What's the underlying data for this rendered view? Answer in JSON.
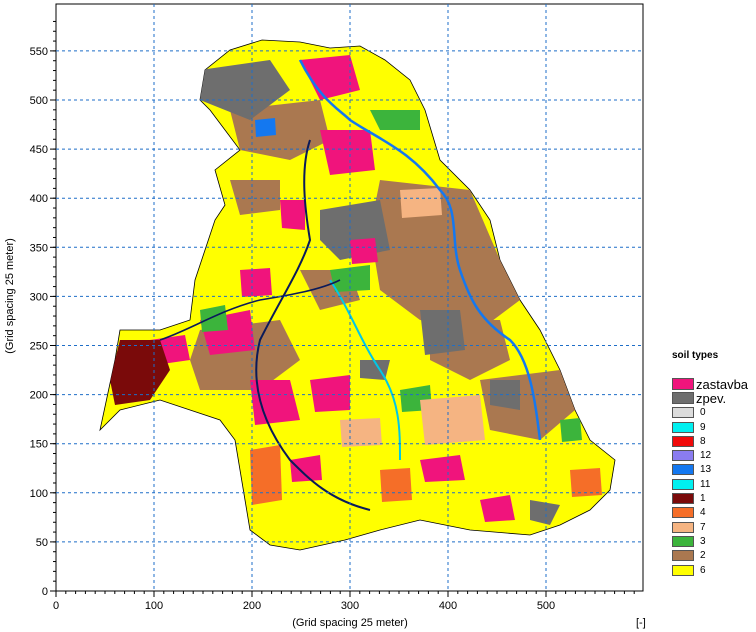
{
  "map": {
    "x_axis": {
      "title": "(Grid spacing 25 meter)",
      "unit_label": "[-]",
      "ticks": [
        "0",
        "100",
        "200",
        "300",
        "400",
        "500"
      ]
    },
    "y_axis": {
      "title": "(Grid spacing 25 meter)",
      "ticks": [
        "0",
        "50",
        "100",
        "150",
        "200",
        "250",
        "300",
        "350",
        "400",
        "450",
        "500",
        "550"
      ]
    },
    "legend": {
      "title": "soil types",
      "items": [
        {
          "label": "zastavba",
          "color": "#f0147c"
        },
        {
          "label": "zpev.",
          "color": "#6e6e6e"
        },
        {
          "label": "0",
          "color": "#dcdcdc"
        },
        {
          "label": "9",
          "color": "#00f0f0"
        },
        {
          "label": "8",
          "color": "#f00a0a"
        },
        {
          "label": "12",
          "color": "#8a7cf0"
        },
        {
          "label": "13",
          "color": "#1478f0"
        },
        {
          "label": "11",
          "color": "#00f0f0"
        },
        {
          "label": "1",
          "color": "#7a0a0a"
        },
        {
          "label": "4",
          "color": "#f56e28"
        },
        {
          "label": "7",
          "color": "#f5b482"
        },
        {
          "label": "3",
          "color": "#3cb43c"
        },
        {
          "label": "2",
          "color": "#aa7850"
        },
        {
          "label": "6",
          "color": "#ffff00"
        }
      ]
    }
  }
}
